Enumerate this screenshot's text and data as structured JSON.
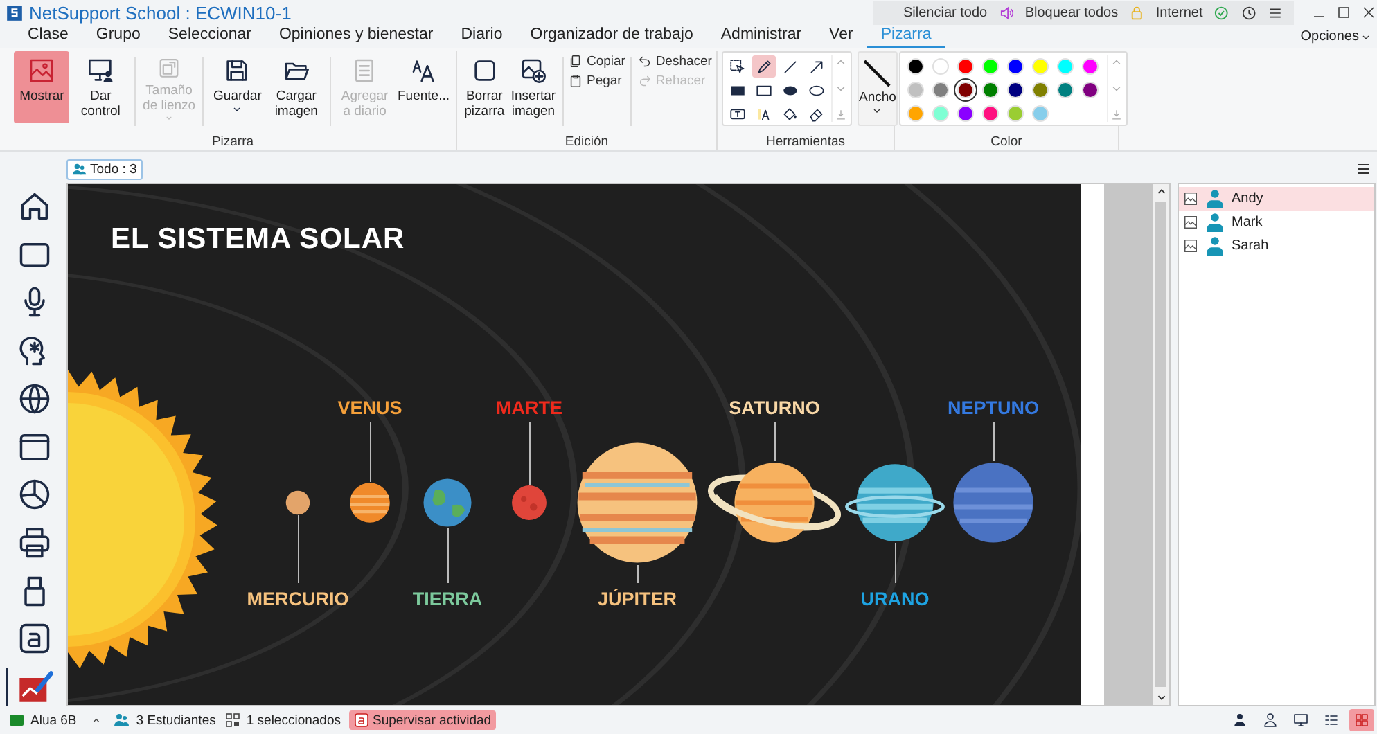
{
  "window": {
    "title": "NetSupport School : ECWIN10-1"
  },
  "top_bar": {
    "mute_all": "Silenciar todo",
    "lock_all": "Bloquear todos",
    "internet": "Internet"
  },
  "menu": [
    {
      "label": "Clase",
      "selected": false
    },
    {
      "label": "Grupo",
      "selected": false
    },
    {
      "label": "Seleccionar",
      "selected": false
    },
    {
      "label": "Opiniones y bienestar",
      "selected": false
    },
    {
      "label": "Diario",
      "selected": false
    },
    {
      "label": "Organizador de trabajo",
      "selected": false
    },
    {
      "label": "Administrar",
      "selected": false
    },
    {
      "label": "Ver",
      "selected": false
    },
    {
      "label": "Pizarra",
      "selected": true
    }
  ],
  "options": "Opciones",
  "ribbon": {
    "board_group": {
      "title": "Pizarra",
      "buttons": [
        {
          "kind": "show",
          "label": "Mostrar",
          "selected": true,
          "disabled": false,
          "dropdown": false
        },
        {
          "kind": "control",
          "label": "Dar control",
          "selected": false,
          "disabled": false,
          "dropdown": false
        },
        {
          "kind": "canvas-size",
          "label": "Tamaño de lienzo",
          "selected": false,
          "disabled": true,
          "dropdown": true
        },
        {
          "kind": "save",
          "label": "Guardar",
          "selected": false,
          "disabled": false,
          "dropdown": true
        },
        {
          "kind": "open",
          "label": "Cargar imagen",
          "selected": false,
          "disabled": false,
          "dropdown": false
        },
        {
          "kind": "journal",
          "label": "Agregar a diario",
          "selected": false,
          "disabled": true,
          "dropdown": false
        },
        {
          "kind": "font",
          "label": "Fuente...",
          "selected": false,
          "disabled": false,
          "dropdown": false
        }
      ]
    },
    "edit_group": {
      "title": "Edición",
      "buttons": [
        {
          "kind": "clear",
          "label": "Borrar pizarra",
          "disabled": false
        },
        {
          "kind": "insert-image",
          "label": "Insertar imagen",
          "disabled": false
        }
      ],
      "small_buttons": [
        {
          "kind": "copy",
          "label": "Copiar",
          "disabled": false
        },
        {
          "kind": "paste",
          "label": "Pegar",
          "disabled": false
        },
        {
          "kind": "undo",
          "label": "Deshacer",
          "disabled": false
        },
        {
          "kind": "redo",
          "label": "Rehacer",
          "disabled": true
        }
      ]
    },
    "tools_group": {
      "title": "Herramientas",
      "tools": [
        {
          "kind": "select",
          "selected": false
        },
        {
          "kind": "pen",
          "selected": true
        },
        {
          "kind": "line",
          "selected": false
        },
        {
          "kind": "arrow",
          "selected": false
        },
        {
          "kind": "rect-filled",
          "selected": false
        },
        {
          "kind": "rect",
          "selected": false
        },
        {
          "kind": "ellipse-filled",
          "selected": false
        },
        {
          "kind": "ellipse",
          "selected": false
        },
        {
          "kind": "textbox",
          "selected": false
        },
        {
          "kind": "highlight",
          "selected": false
        },
        {
          "kind": "fill",
          "selected": false
        },
        {
          "kind": "eraser",
          "selected": false
        }
      ],
      "width_button": "Ancho"
    },
    "color_group": {
      "title": "Color",
      "swatches": [
        {
          "color": "#000000",
          "selected": false
        },
        {
          "color": "#ffffff",
          "selected": false
        },
        {
          "color": "#ff0000",
          "selected": false
        },
        {
          "color": "#00ff00",
          "selected": false
        },
        {
          "color": "#0000ff",
          "selected": false
        },
        {
          "color": "#ffff00",
          "selected": false
        },
        {
          "color": "#00ffff",
          "selected": false
        },
        {
          "color": "#ff00ff",
          "selected": false
        },
        {
          "color": "#c0c0c0",
          "selected": false
        },
        {
          "color": "#808080",
          "selected": false
        },
        {
          "color": "#800000",
          "selected": true
        },
        {
          "color": "#008000",
          "selected": false
        },
        {
          "color": "#000080",
          "selected": false
        },
        {
          "color": "#808000",
          "selected": false
        },
        {
          "color": "#008080",
          "selected": false
        },
        {
          "color": "#800080",
          "selected": false
        },
        {
          "color": "#ffa500",
          "selected": false
        },
        {
          "color": "#7fffd4",
          "selected": false
        },
        {
          "color": "#8a00ff",
          "selected": false
        },
        {
          "color": "#ff1080",
          "selected": false
        },
        {
          "color": "#9acd32",
          "selected": false
        },
        {
          "color": "#87ceeb",
          "selected": false
        }
      ]
    }
  },
  "filter_button": "Todo : 3",
  "sidebar": [
    {
      "kind": "home",
      "selected": false
    },
    {
      "kind": "screen",
      "selected": false
    },
    {
      "kind": "microphone",
      "selected": false
    },
    {
      "kind": "head",
      "selected": false
    },
    {
      "kind": "globe",
      "selected": false
    },
    {
      "kind": "window",
      "selected": false
    },
    {
      "kind": "pie",
      "selected": false
    },
    {
      "kind": "printer",
      "selected": false
    },
    {
      "kind": "usb",
      "selected": false
    },
    {
      "kind": "letter",
      "selected": false
    },
    {
      "kind": "whiteboard",
      "selected": true
    }
  ],
  "board": {
    "title": "EL SISTEMA SOLAR",
    "planets": [
      {
        "name": "MERCURIO",
        "color": "#f6c27e",
        "kind": "label-below"
      },
      {
        "name": "VENUS",
        "color": "#f5a03a",
        "kind": "label-above"
      },
      {
        "name": "TIERRA",
        "color": "#7cc99c",
        "kind": "label-below"
      },
      {
        "name": "MARTE",
        "color": "#ee2a1c",
        "kind": "label-above"
      },
      {
        "name": "JÚPITER",
        "color": "#f6c27e",
        "kind": "label-below"
      },
      {
        "name": "SATURNO",
        "color": "#f8d7a6",
        "kind": "label-above"
      },
      {
        "name": "URANO",
        "color": "#1ea3e2",
        "kind": "label-below"
      },
      {
        "name": "NEPTUNO",
        "color": "#3479e0",
        "kind": "label-above"
      }
    ]
  },
  "students": [
    {
      "name": "Andy",
      "selected": true
    },
    {
      "name": "Mark",
      "selected": false
    },
    {
      "name": "Sarah",
      "selected": false
    }
  ],
  "status_bar": {
    "room": "Alua 6B",
    "students": "3 Estudiantes",
    "selection": "1 seleccionados",
    "monitor": {
      "label": "Supervisar actividad",
      "active": true
    },
    "views": [
      {
        "kind": "person",
        "selected": false
      },
      {
        "kind": "person-outline",
        "selected": false
      },
      {
        "kind": "monitor",
        "selected": false
      },
      {
        "kind": "list",
        "selected": false
      },
      {
        "kind": "grid",
        "selected": true
      }
    ]
  }
}
